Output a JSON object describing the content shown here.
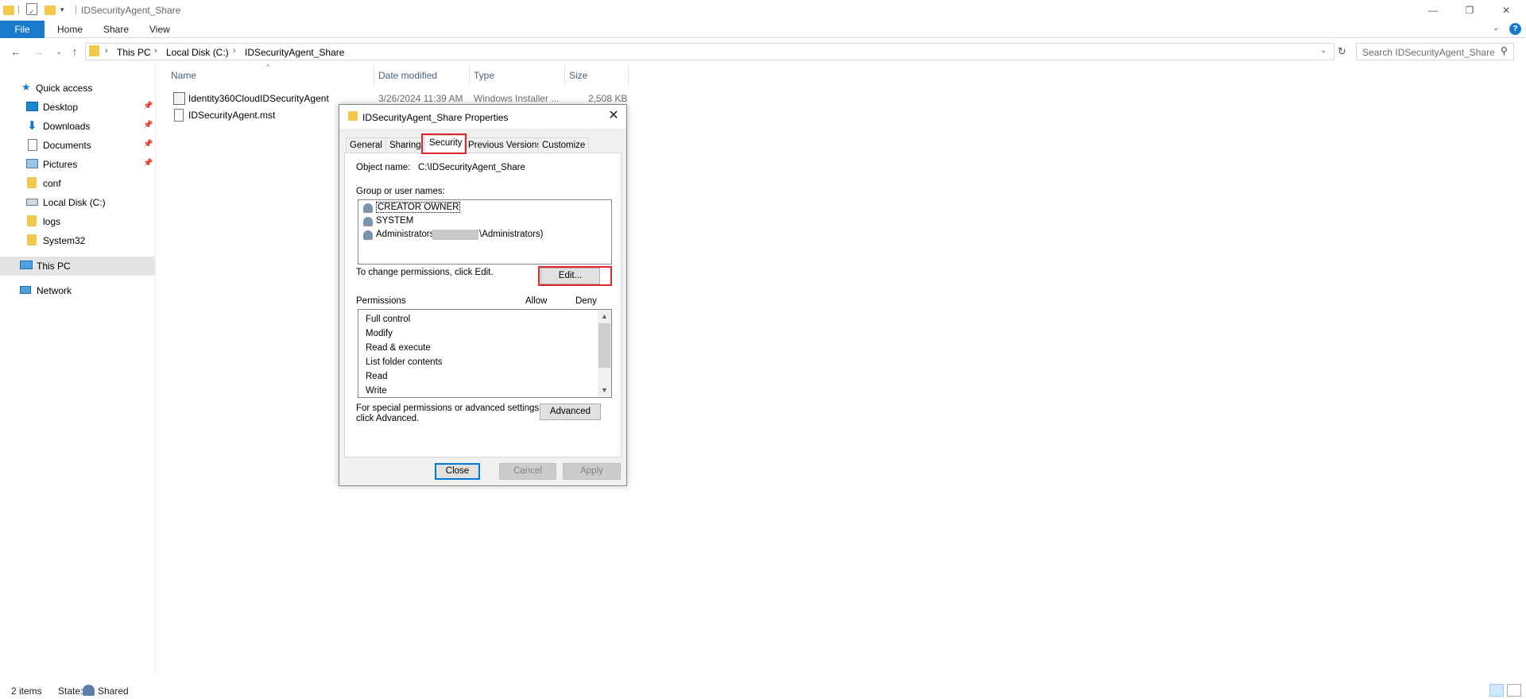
{
  "window": {
    "title": "IDSecurityAgent_Share"
  },
  "ribbon": {
    "tabs": [
      "File",
      "Home",
      "Share",
      "View"
    ]
  },
  "address": {
    "breadcrumbs": [
      "This PC",
      "Local Disk (C:)",
      "IDSecurityAgent_Share"
    ],
    "search_placeholder": "Search IDSecurityAgent_Share"
  },
  "nav": {
    "quick_access": "Quick access",
    "items": [
      {
        "label": "Desktop",
        "pinned": true,
        "icon": "desktop-icon"
      },
      {
        "label": "Downloads",
        "pinned": true,
        "icon": "downloads-icon"
      },
      {
        "label": "Documents",
        "pinned": true,
        "icon": "documents-icon"
      },
      {
        "label": "Pictures",
        "pinned": true,
        "icon": "pictures-icon"
      },
      {
        "label": "conf",
        "pinned": false,
        "icon": "folder-icon"
      },
      {
        "label": "Local Disk (C:)",
        "pinned": false,
        "icon": "drive-icon"
      },
      {
        "label": "logs",
        "pinned": false,
        "icon": "folder-icon"
      },
      {
        "label": "System32",
        "pinned": false,
        "icon": "folder-icon"
      }
    ],
    "this_pc": "This PC",
    "network": "Network"
  },
  "file_list": {
    "columns": [
      "Name",
      "Date modified",
      "Type",
      "Size"
    ],
    "rows": [
      {
        "name": "Identity360CloudIDSecurityAgent",
        "date": "3/26/2024 11:39 AM",
        "type": "Windows Installer ...",
        "size": "2,508 KB"
      },
      {
        "name": "IDSecurityAgent.mst",
        "date": "",
        "type": "",
        "size": ""
      }
    ]
  },
  "status": {
    "items_count": "2 items",
    "state_label": "State:",
    "state_value": "Shared"
  },
  "dialog": {
    "title": "IDSecurityAgent_Share Properties",
    "tabs": [
      "General",
      "Sharing",
      "Security",
      "Previous Versions",
      "Customize"
    ],
    "active_tab": "Security",
    "object_name_label": "Object name:",
    "object_name_value": "C:\\IDSecurityAgent_Share",
    "group_label": "Group or user names:",
    "users": [
      "CREATOR OWNER",
      "SYSTEM",
      "Administrators (",
      "\\Administrators)"
    ],
    "change_perm_text": "To change permissions, click Edit.",
    "edit_button": "Edit...",
    "permissions_label": "Permissions",
    "allow_label": "Allow",
    "deny_label": "Deny",
    "permissions": [
      "Full control",
      "Modify",
      "Read & execute",
      "List folder contents",
      "Read",
      "Write"
    ],
    "special_text_1": "For special permissions or advanced settings,",
    "special_text_2": "click Advanced.",
    "advanced_button": "Advanced",
    "close_button": "Close",
    "cancel_button": "Cancel",
    "apply_button": "Apply",
    "highlight_color": "#e0242c"
  }
}
